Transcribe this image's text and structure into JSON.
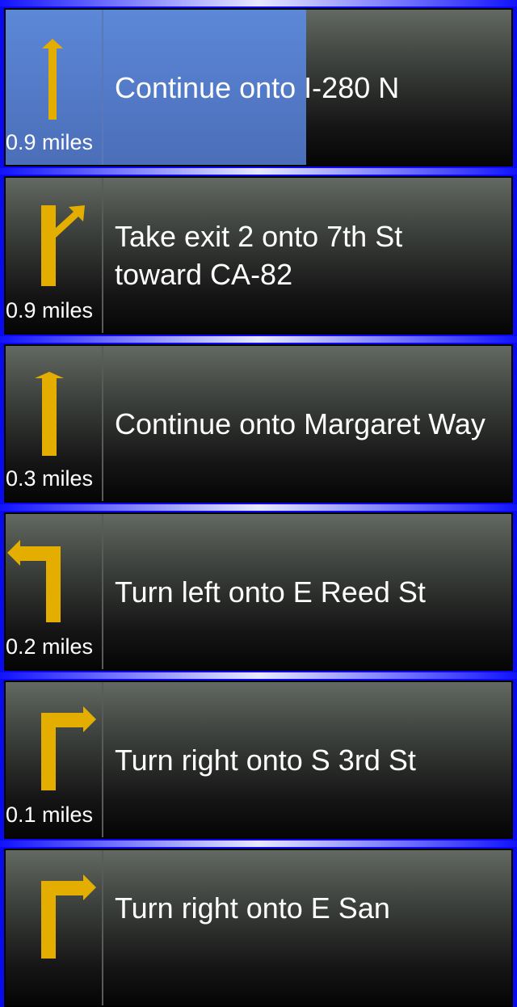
{
  "directions": [
    {
      "distance": "0.9 miles",
      "instruction": "Continue onto I-280 N",
      "maneuver_icon": "straight-arrow-icon",
      "active": true
    },
    {
      "distance": "0.9 miles",
      "instruction": "Take exit 2 onto 7th St toward CA-82",
      "maneuver_icon": "exit-right-arrow-icon",
      "active": false
    },
    {
      "distance": "0.3 miles",
      "instruction": "Continue onto Margaret Way",
      "maneuver_icon": "straight-arrow-icon",
      "active": false
    },
    {
      "distance": "0.2 miles",
      "instruction": "Turn left onto E Reed St",
      "maneuver_icon": "turn-left-arrow-icon",
      "active": false
    },
    {
      "distance": "0.1 miles",
      "instruction": "Turn right onto S 3rd St",
      "maneuver_icon": "turn-right-arrow-icon",
      "active": false
    },
    {
      "distance": "",
      "instruction": "Turn right onto E San",
      "maneuver_icon": "turn-right-arrow-icon",
      "active": false
    }
  ],
  "colors": {
    "arrow": "#e3ae00",
    "highlight": "#5378c8",
    "separator": "#1212ff"
  }
}
